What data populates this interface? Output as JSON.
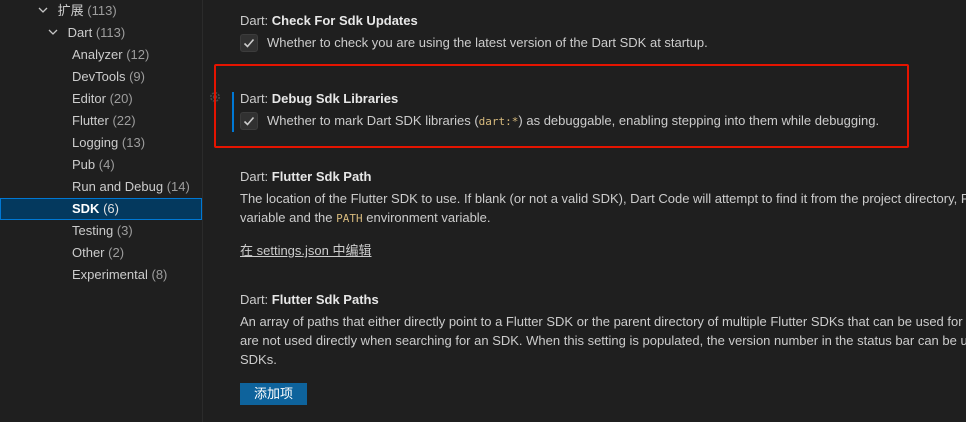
{
  "sidebar": {
    "items": [
      {
        "label": "扩展",
        "count": "(113)",
        "level": 1,
        "expanded": true
      },
      {
        "label": "Dart",
        "count": "(113)",
        "level": 2,
        "expanded": true
      },
      {
        "label": "Analyzer",
        "count": "(12)",
        "level": 3
      },
      {
        "label": "DevTools",
        "count": "(9)",
        "level": 3
      },
      {
        "label": "Editor",
        "count": "(20)",
        "level": 3
      },
      {
        "label": "Flutter",
        "count": "(22)",
        "level": 3
      },
      {
        "label": "Logging",
        "count": "(13)",
        "level": 3
      },
      {
        "label": "Pub",
        "count": "(4)",
        "level": 3
      },
      {
        "label": "Run and Debug",
        "count": "(14)",
        "level": 3
      },
      {
        "label": "SDK",
        "count": "(6)",
        "level": 3,
        "selected": true
      },
      {
        "label": "Testing",
        "count": "(3)",
        "level": 3
      },
      {
        "label": "Other",
        "count": "(2)",
        "level": 3
      },
      {
        "label": "Experimental",
        "count": "(8)",
        "level": 3
      }
    ]
  },
  "settings": {
    "check_updates": {
      "category": "Dart: ",
      "name": "Check For Sdk Updates",
      "description": "Whether to check you are using the latest version of the Dart SDK at startup.",
      "checked": true
    },
    "debug_libraries": {
      "category": "Dart: ",
      "name": "Debug Sdk Libraries",
      "desc_before": "Whether to mark Dart SDK libraries (",
      "desc_code": "dart:*",
      "desc_after": ") as debuggable, enabling stepping into them while debugging.",
      "checked": true
    },
    "flutter_sdk_path": {
      "category": "Dart: ",
      "name": "Flutter Sdk Path",
      "line1": "The location of the Flutter SDK to use. If blank (or not a valid SDK), Dart Code will attempt to find it from the project directory, F",
      "line2_before": "variable and the ",
      "line2_code": "PATH",
      "line2_after": " environment variable.",
      "edit_link": "在 settings.json 中编辑"
    },
    "flutter_sdk_paths": {
      "category": "Dart: ",
      "name": "Flutter Sdk Paths",
      "line1": "An array of paths that either directly point to a Flutter SDK or the parent directory of multiple Flutter SDKs that can be used for",
      "line2": "are not used directly when searching for an SDK. When this setting is populated, the version number in the status bar can be us",
      "line3": "SDKs.",
      "add_button": "添加项"
    }
  },
  "colors": {
    "accent": "#0078d4",
    "highlight_border": "#e51400",
    "button_bg": "#0e639c"
  }
}
